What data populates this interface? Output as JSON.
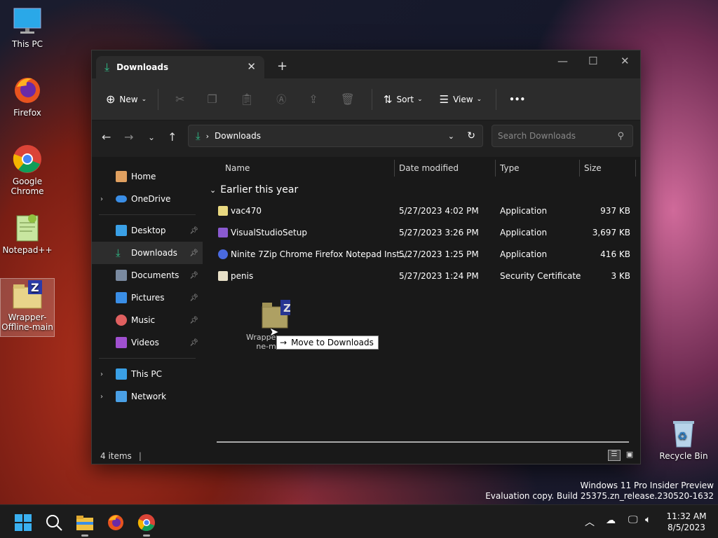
{
  "desktop": {
    "icons": [
      {
        "label": "This PC"
      },
      {
        "label": "Firefox"
      },
      {
        "label": "Google Chrome"
      },
      {
        "label": "Notepad++"
      },
      {
        "label": "Wrapper-Offline-main"
      },
      {
        "label": "Recycle Bin"
      }
    ],
    "watermark_line1": "Windows 11 Pro Insider Preview",
    "watermark_line2": "Evaluation copy. Build 25375.zn_release.230520-1632"
  },
  "window": {
    "tab_title": "Downloads",
    "toolbar": {
      "new_label": "New",
      "sort_label": "Sort",
      "view_label": "View",
      "more_label": "•••"
    },
    "address": {
      "path": "Downloads",
      "search_placeholder": "Search Downloads"
    },
    "sidebar": {
      "items": [
        {
          "label": "Home",
          "color": "#e0a060"
        },
        {
          "label": "OneDrive",
          "color": "#3a8ee6"
        },
        {
          "label": "Desktop",
          "color": "#3aa0e6"
        },
        {
          "label": "Downloads",
          "color": "#2fbf8a"
        },
        {
          "label": "Documents",
          "color": "#7a8aa0"
        },
        {
          "label": "Pictures",
          "color": "#3a8ee6"
        },
        {
          "label": "Music",
          "color": "#e06060"
        },
        {
          "label": "Videos",
          "color": "#a050d0"
        },
        {
          "label": "This PC",
          "color": "#3aa0e6"
        },
        {
          "label": "Network",
          "color": "#4aa0e6"
        }
      ]
    },
    "columns": {
      "name": "Name",
      "date": "Date modified",
      "type": "Type",
      "size": "Size"
    },
    "group_label": "Earlier this year",
    "files": [
      {
        "name": "vac470",
        "date": "5/27/2023 4:02 PM",
        "type": "Application",
        "size": "937 KB"
      },
      {
        "name": "VisualStudioSetup",
        "date": "5/27/2023 3:26 PM",
        "type": "Application",
        "size": "3,697 KB"
      },
      {
        "name": "Ninite 7Zip Chrome Firefox Notepad Inst...",
        "date": "5/27/2023 1:25 PM",
        "type": "Application",
        "size": "416 KB"
      },
      {
        "name": "penis",
        "date": "5/27/2023 1:24 PM",
        "type": "Security Certificate",
        "size": "3 KB"
      }
    ],
    "drag_ghost_label_1": "Wrappe",
    "drag_ghost_label_2": "ne-main",
    "drag_tooltip": "Move to Downloads",
    "status": "4 items"
  },
  "taskbar": {
    "time": "11:32 AM",
    "date": "8/5/2023"
  }
}
